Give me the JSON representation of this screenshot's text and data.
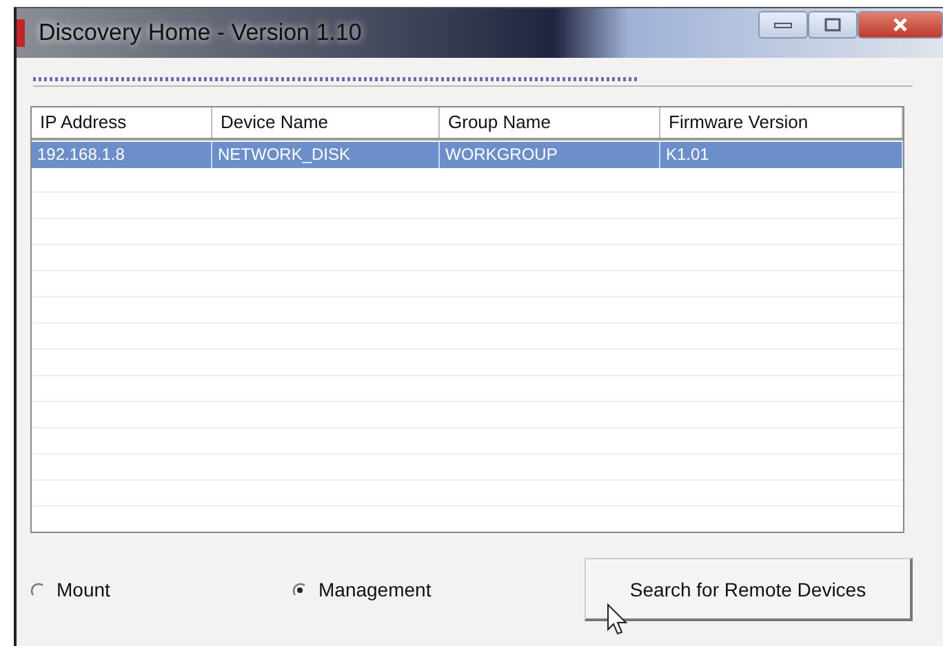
{
  "window": {
    "title": "Discovery Home - Version 1.10"
  },
  "progress": {
    "level": 0.69
  },
  "table": {
    "columns": [
      "IP Address",
      "Device Name",
      "Group Name",
      "Firmware Version"
    ],
    "rows": [
      {
        "cells": [
          "192.168.1.8",
          "NETWORK_DISK",
          "WORKGROUP",
          "K1.01"
        ],
        "selected": true
      }
    ]
  },
  "modes": [
    {
      "label": "Mount",
      "selected": false
    },
    {
      "label": "Management",
      "selected": true
    }
  ],
  "button": "Search for Remote Devices"
}
